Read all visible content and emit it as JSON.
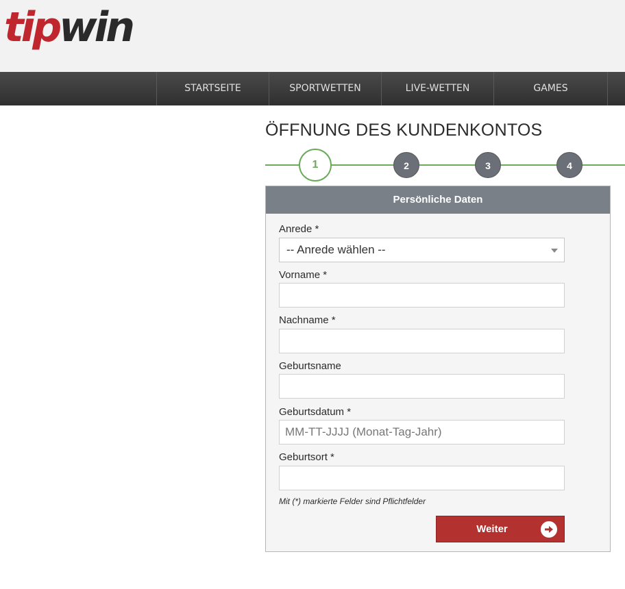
{
  "brand": {
    "logo_tip": "tip",
    "logo_win": "win"
  },
  "nav": {
    "items": [
      "STARTSEITE",
      "SPORTWETTEN",
      "LIVE-WETTEN",
      "GAMES"
    ]
  },
  "page": {
    "title": "ÖFFNUNG DES KUNDENKONTOS"
  },
  "steps": {
    "items": [
      "1",
      "2",
      "3",
      "4"
    ],
    "active": "1"
  },
  "form": {
    "section_title": "Persönliche Daten",
    "anrede": {
      "label": "Anrede *",
      "selected": "-- Anrede wählen --"
    },
    "vorname": {
      "label": "Vorname *",
      "value": ""
    },
    "nachname": {
      "label": "Nachname *",
      "value": ""
    },
    "geburtsname": {
      "label": "Geburtsname",
      "value": ""
    },
    "geburtsdatum": {
      "label": "Geburtsdatum *",
      "placeholder": "MM-TT-JJJJ (Monat-Tag-Jahr)"
    },
    "geburtsort": {
      "label": "Geburtsort *",
      "value": ""
    },
    "required_note": "Mit (*) markierte Felder sind Pflichtfelder",
    "submit_label": "Weiter"
  },
  "colors": {
    "brand_red": "#c0262d",
    "step_green": "#6aaa5a",
    "step_gray": "#6b7078",
    "header_gray": "#7a8088",
    "button_red": "#b3312f"
  }
}
